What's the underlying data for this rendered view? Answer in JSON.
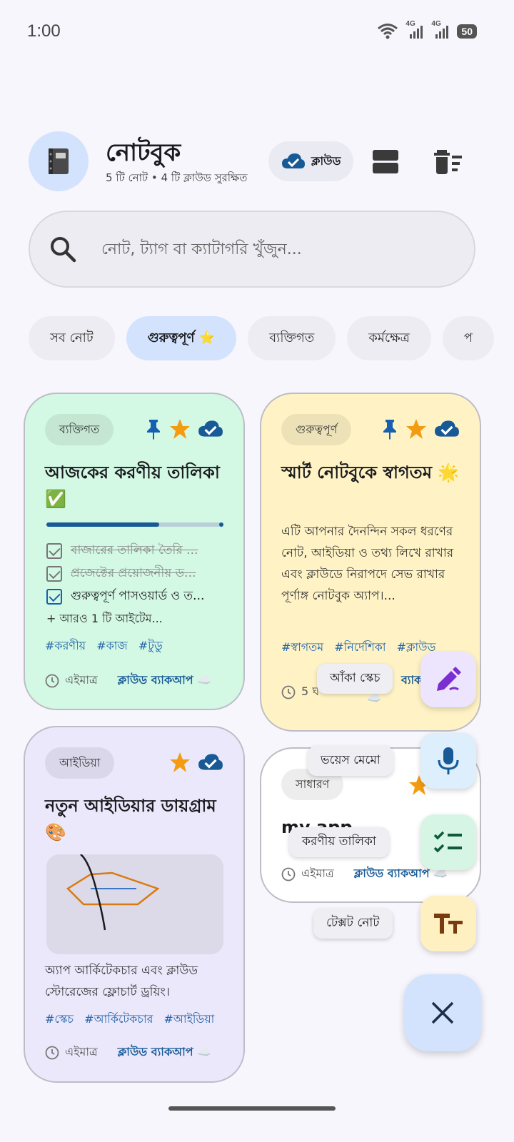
{
  "status_bar": {
    "time": "1:00",
    "network_1": "4G",
    "network_2": "4G",
    "battery": "50"
  },
  "header": {
    "app_icon": "notebook-icon",
    "title": "নোটবুক",
    "subtitle": "5 টি নোট • 4 টি ক্লাউড সুরক্ষিত",
    "cloud_chip_label": "ক্লাউড"
  },
  "search": {
    "placeholder": "নোট, ট্যাগ বা ক্যাটাগরি খুঁজুন..."
  },
  "filter_chips": [
    {
      "label": "সব নোট",
      "active": false
    },
    {
      "label": "গুরুত্বপূর্ণ ⭐",
      "active": true
    },
    {
      "label": "ব্যক্তিগত",
      "active": false
    },
    {
      "label": "কর্মক্ষেত্র",
      "active": false
    },
    {
      "label": "প",
      "active": false
    }
  ],
  "notes": [
    {
      "category": "ব্যক্তিগত",
      "title": "আজকের করণীয় তালিকা ✅",
      "bg": "#D3F8E4",
      "pinned": true,
      "starred": true,
      "cloud": true,
      "progress": 0.67,
      "checklist": [
        {
          "text": "বাজারের তালিকা তৈরি ...",
          "done": true
        },
        {
          "text": "প্রজেক্টের প্রয়োজনীয় ড...",
          "done": true
        },
        {
          "text": "গুরুত্বপূর্ণ পাসওয়ার্ড ও ত...",
          "done": false
        }
      ],
      "more": "+ আরও 1 টি আইটেম...",
      "tags": [
        "#করণীয়",
        "#কাজ",
        "#টুডু"
      ],
      "time": "এইমাত্র",
      "backup": "ক্লাউড ব্যাকআপ ☁️"
    },
    {
      "category": "গুরুত্বপূর্ণ",
      "title": "স্মার্ট নোটবুকে স্বাগতম 🌟",
      "bg": "#FFF3C6",
      "pinned": true,
      "starred": true,
      "cloud": true,
      "body": "এটি আপনার দৈনন্দিন সকল ধরণের নোট, আইডিয়া ও তথ্য লিখে রাখার এবং ক্লাউডে নিরাপদে সেভ রাখার পূর্ণাঙ্গ নোটবুক অ্যাপ।...",
      "tags": [
        "#স্বাগতম",
        "#নির্দেশিকা",
        "#ক্লাউড"
      ],
      "time": "5 ঘ",
      "backup": "ব্যাক",
      "backup_cloud": "☁️"
    },
    {
      "category": "আইডিয়া",
      "title": "নতুন আইডিয়ার ডায়গ্রাম 🎨",
      "bg": "#ECE8FC",
      "pinned": false,
      "starred": true,
      "cloud": true,
      "body": "অ্যাপ আর্কিটেকচার এবং ক্লাউড স্টোরেজের ফ্লোচার্ট ড্রয়িং।",
      "tags": [
        "#স্কেচ",
        "#আর্কিটেকচার",
        "#আইডিয়া"
      ],
      "time": "এইমাত্র",
      "backup": "ক্লাউড ব্যাকআপ ☁️"
    },
    {
      "category": "সাধারণ",
      "title": "my app",
      "bg": "#FFFFFF",
      "starred": true,
      "time": "এইমাত্র",
      "backup": "ক্লাউড ব্যাকআপ ☁️"
    }
  ],
  "fab_menu": [
    {
      "label": "আঁকা স্কেচ",
      "icon": "draw-icon",
      "bg": "#EDE5FD"
    },
    {
      "label": "ভয়েস মেমো",
      "icon": "mic-icon",
      "bg": "#DDEEFC"
    },
    {
      "label": "করণীয় তালিকা",
      "icon": "checklist-icon",
      "bg": "#D7F5E5"
    },
    {
      "label": "টেক্সট নোট",
      "icon": "text-format-icon",
      "bg": "#FFF0C2"
    }
  ],
  "fab_main_icon": "close-icon",
  "colors": {
    "accent": "#175A96",
    "pin": "#1660B0",
    "star": "#F39C12"
  }
}
